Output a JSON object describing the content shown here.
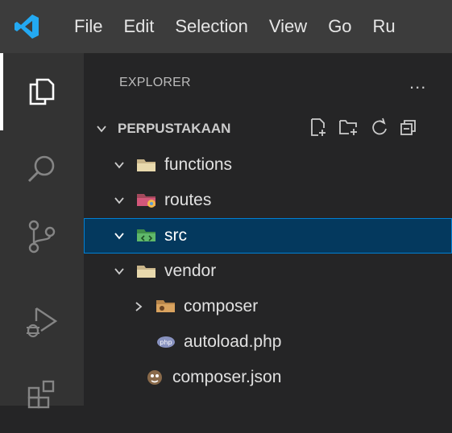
{
  "menu": {
    "items": [
      "File",
      "Edit",
      "Selection",
      "View",
      "Go",
      "Ru"
    ]
  },
  "activity_bar": {
    "items": [
      {
        "icon": "explorer-icon",
        "active": true
      },
      {
        "icon": "search-icon",
        "active": false
      },
      {
        "icon": "source-control-icon",
        "active": false
      },
      {
        "icon": "run-debug-icon",
        "active": false
      },
      {
        "icon": "extensions-icon",
        "active": false
      }
    ]
  },
  "explorer": {
    "title": "EXPLORER",
    "more_label": "...",
    "section": {
      "name": "PERPUSTAKAAN",
      "actions": [
        "new-file-icon",
        "new-folder-icon",
        "refresh-icon",
        "collapse-all-icon"
      ]
    },
    "tree": [
      {
        "label": "functions",
        "type": "folder",
        "expanded": true,
        "icon": "folder-icon"
      },
      {
        "label": "routes",
        "type": "folder",
        "expanded": true,
        "icon": "routes-folder-icon"
      },
      {
        "label": "src",
        "type": "folder",
        "expanded": true,
        "icon": "src-folder-icon",
        "selected": true
      },
      {
        "label": "vendor",
        "type": "folder",
        "expanded": true,
        "icon": "folder-icon"
      },
      {
        "label": "composer",
        "type": "folder",
        "expanded": false,
        "icon": "composer-folder-icon"
      },
      {
        "label": "autoload.php",
        "type": "file",
        "icon": "php-file-icon"
      },
      {
        "label": "composer.json",
        "type": "file",
        "icon": "composer-json-icon"
      }
    ]
  },
  "colors": {
    "titlebar": "#3c3c3c",
    "activity_bar": "#333333",
    "sidebar": "#252526",
    "selection_bg": "#04395e",
    "selection_border": "#007fd4",
    "vscode_blue": "#23a9f2"
  }
}
